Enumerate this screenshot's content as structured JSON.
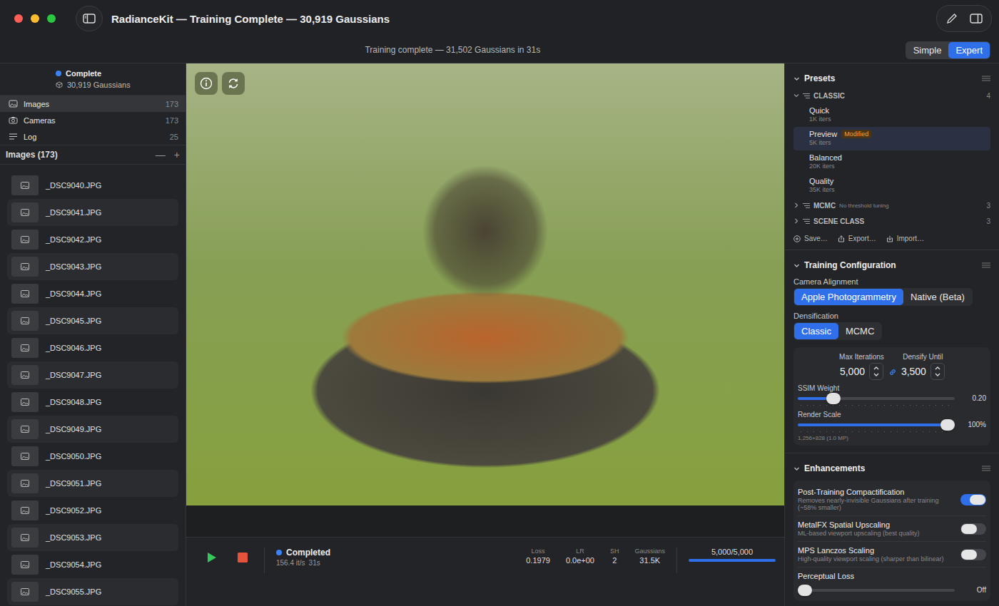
{
  "window": {
    "title": "RadianceKit — Training Complete — 30,919 Gaussians"
  },
  "toolbar": {
    "status": "Training complete — 31,502 Gaussians in 31s",
    "modes": [
      {
        "label": "Simple",
        "selected": false
      },
      {
        "label": "Expert",
        "selected": true
      }
    ]
  },
  "sidebar": {
    "status": {
      "label": "Complete",
      "count": "30,919 Gaussians"
    },
    "nav": [
      {
        "label": "Images",
        "count": "173",
        "selected": true
      },
      {
        "label": "Cameras",
        "count": "173",
        "selected": false
      },
      {
        "label": "Log",
        "count": "25",
        "selected": false
      }
    ],
    "list_title": "Images (173)",
    "list_actions": [
      "—",
      "+"
    ],
    "images": [
      "_DSC9040.JPG",
      "_DSC9041.JPG",
      "_DSC9042.JPG",
      "_DSC9043.JPG",
      "_DSC9044.JPG",
      "_DSC9045.JPG",
      "_DSC9046.JPG",
      "_DSC9047.JPG",
      "_DSC9048.JPG",
      "_DSC9049.JPG",
      "_DSC9050.JPG",
      "_DSC9051.JPG",
      "_DSC9052.JPG",
      "_DSC9053.JPG",
      "_DSC9054.JPG",
      "_DSC9055.JPG"
    ]
  },
  "playback": {
    "state": "Completed",
    "rate": "156.4 it/s",
    "time": "31s",
    "stats": [
      {
        "label": "Loss",
        "value": "0.1979"
      },
      {
        "label": "LR",
        "value": "0.0e+00"
      },
      {
        "label": "SH",
        "value": "2"
      },
      {
        "label": "Gaussians",
        "value": "31.5K"
      }
    ],
    "progress": {
      "label": "5,000/5,000",
      "level": 1
    }
  },
  "presets": {
    "title": "Presets",
    "groups": [
      {
        "name": "CLASSIC",
        "note": "",
        "count": "4",
        "expanded": true,
        "items": [
          {
            "name": "Quick",
            "detail": "1K iters",
            "badge": "",
            "selected": false
          },
          {
            "name": "Preview",
            "detail": "5K iters",
            "badge": "Modified",
            "selected": true
          },
          {
            "name": "Balanced",
            "detail": "20K iters",
            "badge": "",
            "selected": false
          },
          {
            "name": "Quality",
            "detail": "35K iters",
            "badge": "",
            "selected": false
          }
        ]
      },
      {
        "name": "MCMC",
        "note": "No threshold tuning",
        "count": "3",
        "expanded": false,
        "items": []
      },
      {
        "name": "SCENE CLASS",
        "note": "",
        "count": "3",
        "expanded": false,
        "items": []
      }
    ],
    "actions": [
      "Save…",
      "Export…",
      "Import…"
    ]
  },
  "training": {
    "title": "Training Configuration",
    "camera_alignment": {
      "label": "Camera Alignment",
      "options": [
        {
          "label": "Apple Photogrammetry",
          "selected": true
        },
        {
          "label": "Native (Beta)",
          "selected": false
        }
      ]
    },
    "densification": {
      "label": "Densification",
      "options": [
        {
          "label": "Classic",
          "selected": true
        },
        {
          "label": "MCMC",
          "selected": false
        }
      ]
    },
    "max_iterations": {
      "label": "Max Iterations",
      "value": "5,000"
    },
    "densify_until": {
      "label": "Densify Until",
      "value": "3,500",
      "linked": true
    },
    "ssim": {
      "label": "SSIM Weight",
      "reading": "0.20",
      "level": 0.2
    },
    "render_scale": {
      "label": "Render Scale",
      "reading": "100%",
      "level": 1,
      "note": "1,256×828 (1.0 MP)"
    }
  },
  "enhancements": {
    "title": "Enhancements",
    "items": [
      {
        "kind": "toggle",
        "label": "Post-Training Compactification",
        "description": "Removes nearly-invisible Gaussians after training (~58% smaller)",
        "on": true
      },
      {
        "kind": "toggle",
        "label": "MetalFX Spatial Upscaling",
        "description": "ML-based viewport upscaling (best quality)",
        "on": false
      },
      {
        "kind": "toggle",
        "label": "MPS Lanczos Scaling",
        "description": "High-quality viewport scaling (sharper than bilinear)",
        "on": false
      },
      {
        "kind": "slider",
        "label": "Perceptual Loss",
        "reading": "Off",
        "level": 0
      }
    ]
  }
}
